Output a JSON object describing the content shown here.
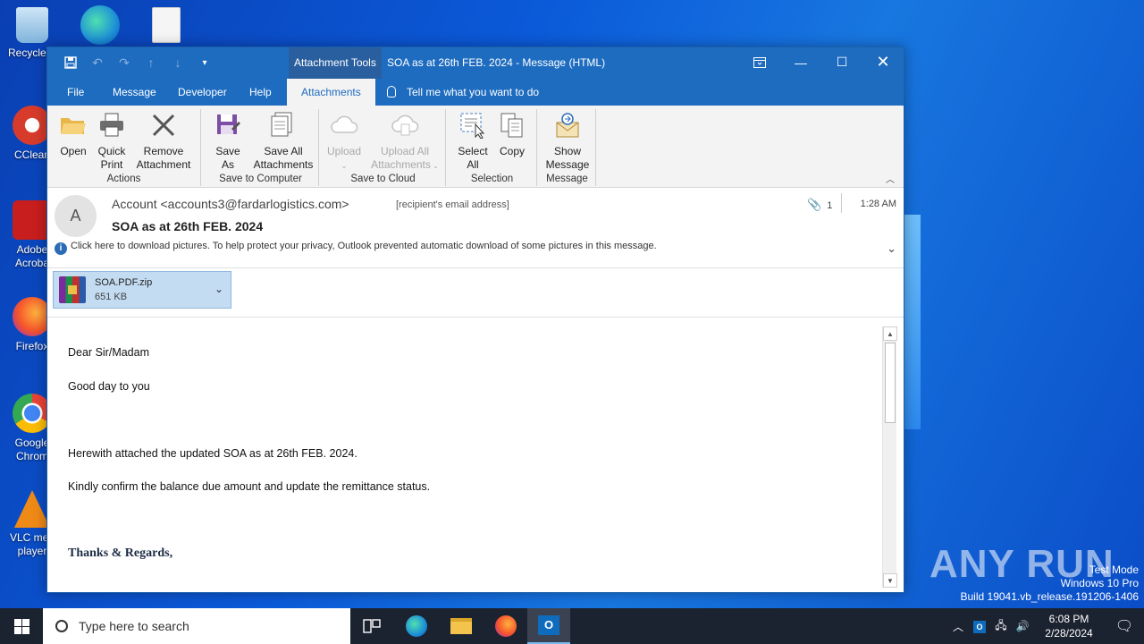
{
  "desktop": {
    "icons": [
      {
        "label": "Recycle B",
        "icon": "recycle-bin-icon"
      },
      {
        "label": "CClean",
        "icon": "ccleaner-icon"
      },
      {
        "label": "Adobe Acroba",
        "icon": "adobe-acrobat-icon"
      },
      {
        "label": "Firefox",
        "icon": "firefox-icon"
      },
      {
        "label": "Google Chrom",
        "icon": "chrome-icon"
      },
      {
        "label": "VLC med player",
        "icon": "vlc-icon"
      }
    ]
  },
  "window": {
    "context_tab": "Attachment Tools",
    "title": "SOA as at 26th  FEB. 2024  -  Message (HTML)",
    "tabs": [
      "File",
      "Message",
      "Developer",
      "Help",
      "Attachments"
    ],
    "active_tab": "Attachments",
    "tell_me": "Tell me what you want to do"
  },
  "ribbon": {
    "groups": {
      "actions": "Actions",
      "save_to_computer": "Save to Computer",
      "save_to_cloud": "Save to Cloud",
      "selection": "Selection",
      "message": "Message"
    },
    "buttons": {
      "open": "Open",
      "quick_print_1": "Quick",
      "quick_print_2": "Print",
      "remove_1": "Remove",
      "remove_2": "Attachment",
      "save_as_1": "Save",
      "save_as_2": "As",
      "save_all_1": "Save All",
      "save_all_2": "Attachments",
      "upload": "Upload",
      "upload_all_1": "Upload All",
      "upload_all_2": "Attachments",
      "select_all_1": "Select",
      "select_all_2": "All",
      "copy": "Copy",
      "show_message_1": "Show",
      "show_message_2": "Message"
    }
  },
  "message": {
    "avatar_letter": "A",
    "from": "Account <accounts3@fardarlogistics.com>",
    "to": "[recipient's email address]",
    "subject": "SOA as at 26th  FEB. 2024",
    "attachment_count": "1",
    "time": "1:28 AM",
    "info_bar": "Click here to download pictures. To help protect your privacy, Outlook prevented automatic download of some pictures in this message.",
    "attachment": {
      "name": "SOA.PDF.zip",
      "size": "651 KB"
    },
    "body": {
      "greeting": "Dear Sir/Madam",
      "line1": "Good day to you",
      "line2": "Herewith attached the updated SOA as at 26th  FEB. 2024.",
      "line3": "Kindly confirm the balance due amount and update  the remittance status.",
      "signoff": "Thanks & Regards,"
    }
  },
  "watermark": {
    "brand": "ANY RUN",
    "test_mode": "Test Mode",
    "edition": "Windows 10 Pro",
    "build": "Build 19041.vb_release.191206-1406"
  },
  "taskbar": {
    "search_placeholder": "Type here to search",
    "time": "6:08 PM",
    "date": "2/28/2024"
  }
}
